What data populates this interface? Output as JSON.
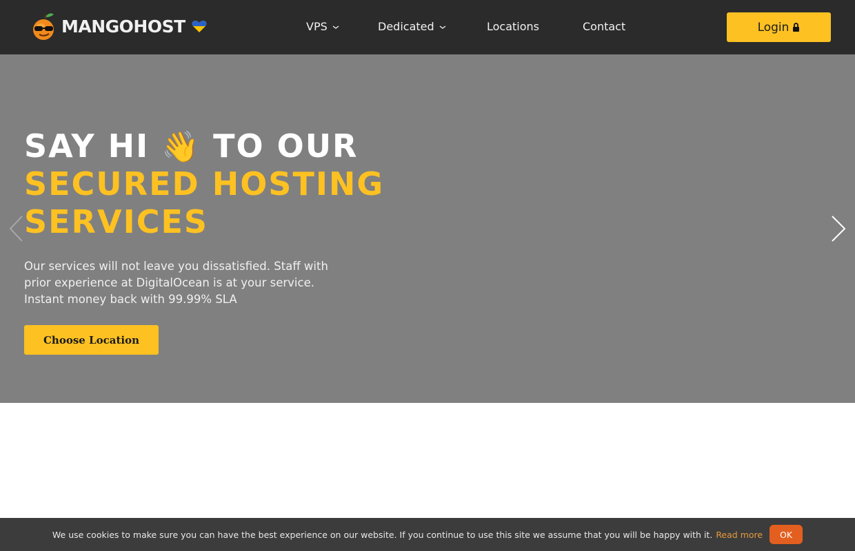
{
  "header": {
    "logo_text": "MANGOHOST",
    "nav": [
      {
        "label": "VPS",
        "has_dropdown": true
      },
      {
        "label": "Dedicated",
        "has_dropdown": true
      },
      {
        "label": "Locations",
        "has_dropdown": false
      },
      {
        "label": "Contact",
        "has_dropdown": false
      }
    ],
    "login_label": "Login",
    "login_icon": "lock-icon"
  },
  "hero": {
    "line1_pre": "SAY HI",
    "line1_emoji": "👋",
    "line1_post": "TO OUR",
    "line2": "SECURED HOSTING",
    "line3": "SERVICES",
    "description_lines": [
      "Our services will not leave you dissatisfied. Staff with",
      "prior experience at DigitalOcean is at your service.",
      "Instant money back with 99.99% SLA"
    ],
    "cta_label": "Choose Location",
    "prev_icon": "chevron-left-icon",
    "next_icon": "chevron-right-icon"
  },
  "cookie": {
    "message": "We use cookies to make sure you can have the best experience on our website. If you continue to use this site we assume that you will be happy with it.",
    "read_more": "Read more",
    "ok_label": "OK"
  },
  "colors": {
    "header_bg": "#2b2b2b",
    "accent": "#fdc122",
    "hero_bg": "#808080",
    "cookie_bg": "#3c3c3c",
    "cookie_link": "#e89a3c",
    "ok_button": "#e35f1f"
  }
}
